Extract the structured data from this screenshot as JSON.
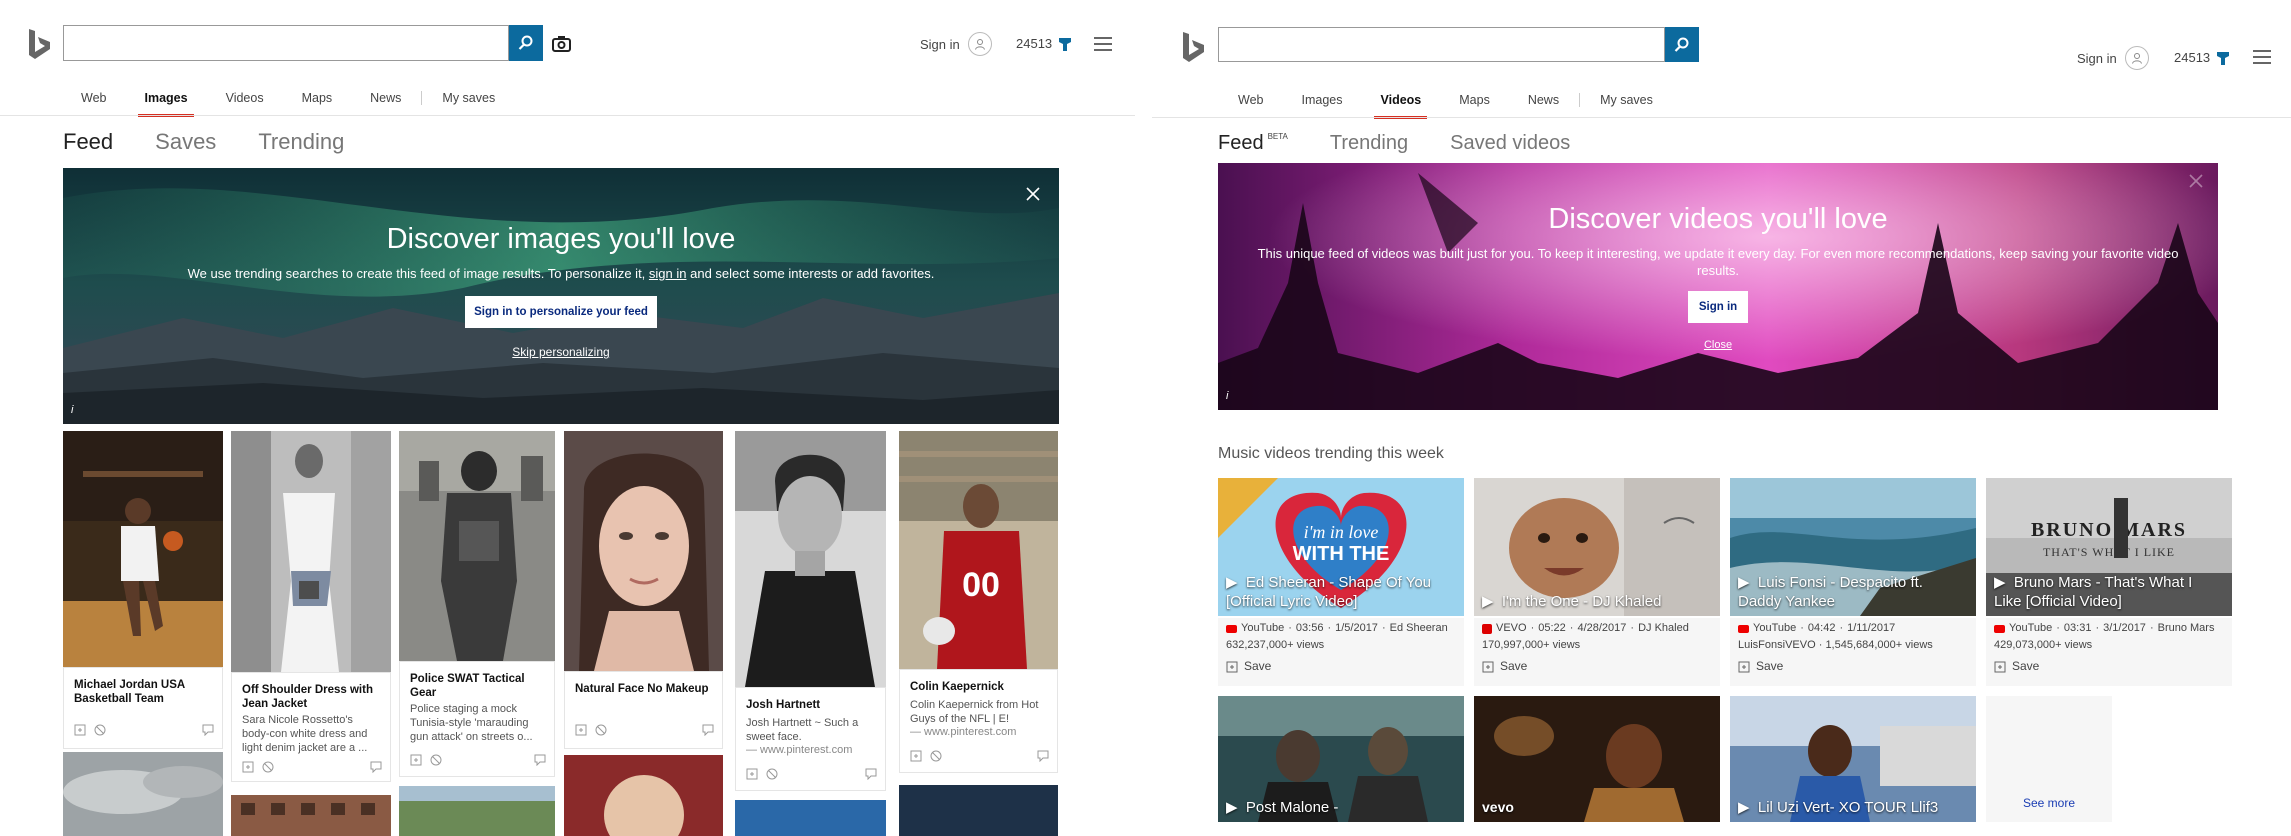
{
  "left": {
    "header": {
      "search_value": "",
      "signin_label": "Sign in",
      "rewards_points": "24513"
    },
    "scopes": [
      "Web",
      "Images",
      "Videos",
      "Maps",
      "News",
      "My saves"
    ],
    "active_scope": "Images",
    "subtabs": [
      "Feed",
      "Saves",
      "Trending"
    ],
    "hero": {
      "title": "Discover images you'll love",
      "text_before": "We use trending searches to create this feed of image results. To personalize it,",
      "text_link": "sign in",
      "text_after": "and select some interests or add favorites.",
      "button_label": "Sign in to personalize your feed",
      "skip_label": "Skip personalizing",
      "info_label": "i"
    },
    "cards": [
      {
        "title": "Michael Jordan USA Basketball Team",
        "desc": "",
        "source": ""
      },
      {
        "title": "Off Shoulder Dress with Jean Jacket",
        "desc": "Sara Nicole Rossetto's body-con white dress and light denim jacket are a ...",
        "source": ""
      },
      {
        "title": "Police SWAT Tactical Gear",
        "desc": "Police staging a mock Tunisia-style 'marauding gun attack' on streets o...",
        "source": ""
      },
      {
        "title": "Natural Face No Makeup",
        "desc": "",
        "source": ""
      },
      {
        "title": "Josh Hartnett",
        "desc": "Josh Hartnett ~ Such a sweet face.",
        "source": "— www.pinterest.com"
      },
      {
        "title": "Colin Kaepernick",
        "desc": "Colin Kaepernick from Hot Guys of the NFL | E!",
        "source": "— www.pinterest.com"
      }
    ]
  },
  "right": {
    "header": {
      "search_value": "",
      "signin_label": "Sign in",
      "rewards_points": "24513"
    },
    "scopes": [
      "Web",
      "Images",
      "Videos",
      "Maps",
      "News",
      "My saves"
    ],
    "active_scope": "Videos",
    "subtabs": [
      "Feed",
      "Trending",
      "Saved videos"
    ],
    "beta_label": "BETA",
    "hero": {
      "title": "Discover videos you'll love",
      "text": "This unique feed of videos was built just for you. To keep it interesting, we update it every day. For even more recommendations, keep saving your favorite video results.",
      "button_label": "Sign in",
      "close_label": "Close",
      "info_label": "i"
    },
    "section_title": "Music videos trending this week",
    "videos": [
      {
        "caption": "Ed Sheeran - Shape Of You [Official Lyric Video]",
        "source": "YouTube",
        "duration": "03:56",
        "date": "1/5/2017",
        "channel": "Ed Sheeran",
        "views": "632,237,000+ views",
        "save_label": "Save"
      },
      {
        "caption": "I'm the One - DJ Khaled",
        "source": "VEVO",
        "duration": "05:22",
        "date": "4/28/2017",
        "channel": "DJ Khaled",
        "views": "170,997,000+ views",
        "save_label": "Save"
      },
      {
        "caption": "Luis Fonsi - Despacito ft. Daddy Yankee",
        "source": "YouTube",
        "duration": "04:42",
        "date": "1/11/2017",
        "channel": "LuisFonsiVEVO",
        "views": "1,545,684,000+ views",
        "save_label": "Save"
      },
      {
        "caption": "Bruno Mars - That's What I Like [Official Video]",
        "source": "YouTube",
        "duration": "03:31",
        "date": "3/1/2017",
        "channel": "Bruno Mars",
        "views": "429,073,000+ views",
        "save_label": "Save"
      }
    ],
    "videos_row2": [
      {
        "caption": "Post Malone -"
      },
      {
        "caption": "vevo"
      },
      {
        "caption": "Lil Uzi Vert- XO TOUR Llif3"
      }
    ],
    "see_more_label": "See more"
  },
  "colors": {
    "accent_red": "#d63022",
    "bing_blue": "#0c6a9e",
    "link_blue": "#1a3db3"
  }
}
